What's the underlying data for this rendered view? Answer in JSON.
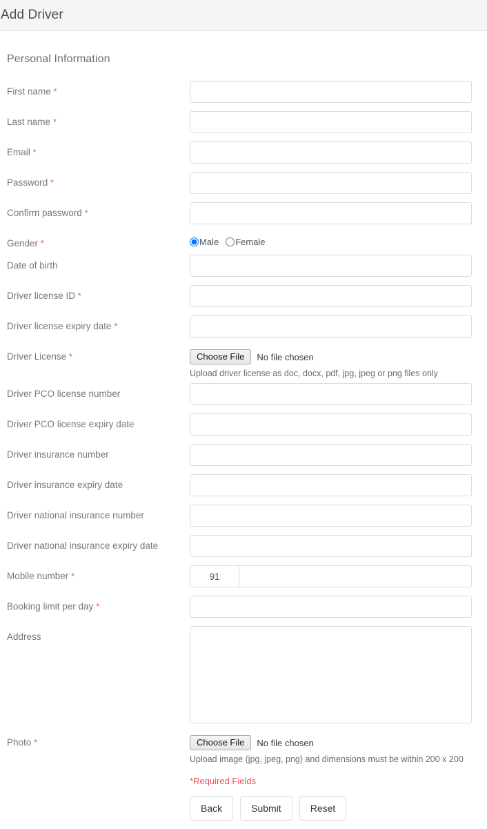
{
  "header": {
    "title": "Add Driver"
  },
  "section": {
    "title": "Personal Information"
  },
  "fields": {
    "first_name": {
      "label": "First name",
      "required": "*"
    },
    "last_name": {
      "label": "Last name",
      "required": "*"
    },
    "email": {
      "label": "Email",
      "required": "*"
    },
    "password": {
      "label": "Password",
      "required": "*"
    },
    "confirm_password": {
      "label": "Confirm password",
      "required": "*"
    },
    "gender": {
      "label": "Gender",
      "required": "*"
    },
    "date_of_birth": {
      "label": "Date of birth",
      "required": ""
    },
    "license_id": {
      "label": "Driver license ID",
      "required": "*"
    },
    "license_expiry": {
      "label": "Driver license expiry date",
      "required": "*"
    },
    "driver_license": {
      "label": "Driver License",
      "required": "*"
    },
    "pco_number": {
      "label": "Driver PCO license number",
      "required": ""
    },
    "pco_expiry": {
      "label": "Driver PCO license expiry date",
      "required": ""
    },
    "insurance_number": {
      "label": "Driver insurance number",
      "required": ""
    },
    "insurance_expiry": {
      "label": "Driver insurance expiry date",
      "required": ""
    },
    "nat_ins_number": {
      "label": "Driver national insurance number",
      "required": ""
    },
    "nat_ins_expiry": {
      "label": "Driver national insurance expiry date",
      "required": ""
    },
    "mobile_number": {
      "label": "Mobile number",
      "required": "*"
    },
    "booking_limit": {
      "label": "Booking limit per day",
      "required": "*"
    },
    "address": {
      "label": "Address",
      "required": ""
    },
    "photo": {
      "label": "Photo",
      "required": "*"
    }
  },
  "values": {
    "first_name": "",
    "last_name": "",
    "email": "",
    "password": "",
    "confirm_password": "",
    "date_of_birth": "",
    "license_id": "",
    "license_expiry": "",
    "pco_number": "",
    "pco_expiry": "",
    "insurance_number": "",
    "insurance_expiry": "",
    "nat_ins_number": "",
    "nat_ins_expiry": "",
    "mobile_prefix": "91",
    "mobile_number": "",
    "booking_limit": "",
    "address": ""
  },
  "gender": {
    "options": [
      {
        "label": "Male",
        "value": "male",
        "selected": true
      },
      {
        "label": "Female",
        "value": "female",
        "selected": false
      }
    ]
  },
  "file_inputs": {
    "driver_license": {
      "button_label": "Choose File",
      "status": "No file chosen",
      "help": "Upload driver license as doc, docx, pdf, jpg, jpeg or png files only"
    },
    "photo": {
      "button_label": "Choose File",
      "status": "No file chosen",
      "help": "Upload image (jpg, jpeg, png) and dimensions must be within 200 x 200"
    }
  },
  "footer": {
    "required_note": "*Required Fields",
    "buttons": [
      {
        "label": "Back",
        "name": "back-button"
      },
      {
        "label": "Submit",
        "name": "submit-button"
      },
      {
        "label": "Reset",
        "name": "reset-button"
      }
    ]
  },
  "colors": {
    "required_asterisk": "#e8605a",
    "required_note": "#f0534c",
    "header_bg": "#f5f5f5",
    "label_text": "#777777",
    "input_border": "#dcdcdc"
  }
}
